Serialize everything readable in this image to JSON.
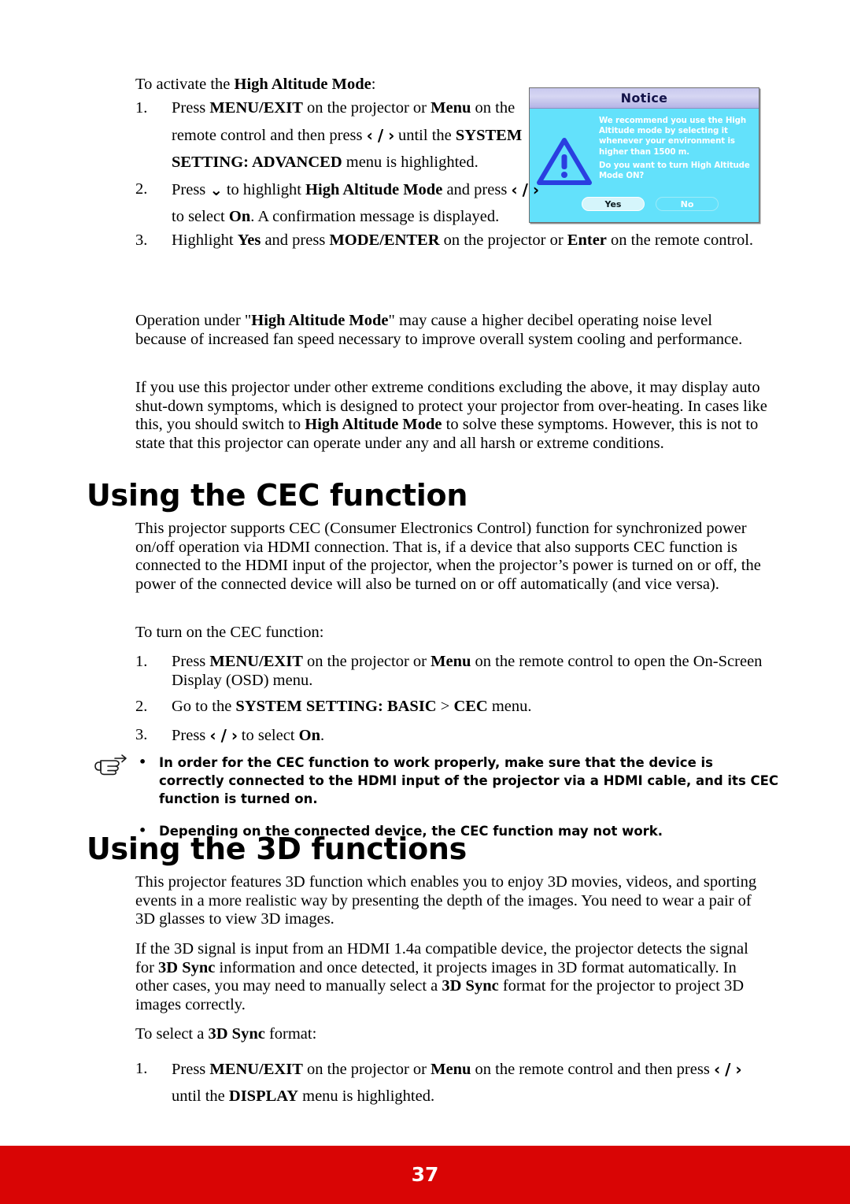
{
  "document": {
    "page_number": "37",
    "footer_color": "#d90505"
  },
  "high_altitude": {
    "lead_in_pre": "To activate the ",
    "lead_in_bold": "High Altitude Mode",
    "lead_in_post": ":",
    "steps": [
      {
        "num": "1.",
        "segments": [
          {
            "t": "Press ",
            "style": "normal"
          },
          {
            "t": "MENU/EXIT",
            "style": "bold"
          },
          {
            "t": " on the projector or ",
            "style": "normal"
          },
          {
            "t": "Menu",
            "style": "bold"
          },
          {
            "t": " on the remote control and then press ",
            "style": "normal"
          },
          {
            "t": "‹ / ›",
            "style": "glyph"
          },
          {
            "t": " until the ",
            "style": "normal"
          },
          {
            "t": "SYSTEM SETTING: ADVANCED",
            "style": "bold"
          },
          {
            "t": " menu is highlighted.",
            "style": "normal"
          }
        ]
      },
      {
        "num": "2.",
        "segments": [
          {
            "t": "Press ",
            "style": "normal"
          },
          {
            "t": "⌄",
            "style": "glyph-down"
          },
          {
            "t": " to highlight ",
            "style": "normal"
          },
          {
            "t": "High Altitude Mode",
            "style": "bold"
          },
          {
            "t": " and press ",
            "style": "normal"
          },
          {
            "t": "‹ / ›",
            "style": "glyph"
          },
          {
            "t": " to select ",
            "style": "normal"
          },
          {
            "t": "On",
            "style": "bold"
          },
          {
            "t": ". A confirmation message is displayed.",
            "style": "normal"
          }
        ]
      },
      {
        "num": "3.",
        "segments": [
          {
            "t": "Highlight ",
            "style": "normal"
          },
          {
            "t": "Yes",
            "style": "bold"
          },
          {
            "t": " and press ",
            "style": "normal"
          },
          {
            "t": "MODE/ENTER",
            "style": "bold"
          },
          {
            "t": " on the projector or ",
            "style": "normal"
          },
          {
            "t": "Enter",
            "style": "bold"
          },
          {
            "t": " on the remote control.",
            "style": "normal"
          }
        ]
      }
    ],
    "paragraph_1": [
      {
        "t": "Operation under \"",
        "style": "normal"
      },
      {
        "t": "High Altitude Mode",
        "style": "bold"
      },
      {
        "t": "\" may cause a higher decibel operating noise level because of increased fan speed necessary to improve overall system cooling and performance.",
        "style": "normal"
      }
    ],
    "paragraph_2": [
      {
        "t": "If you use this projector under other extreme conditions excluding the above, it may display auto shut-down symptoms, which is designed to protect your projector from over-heating. In cases like this, you should switch to ",
        "style": "normal"
      },
      {
        "t": "High Altitude Mode",
        "style": "bold"
      },
      {
        "t": " to solve these symptoms. However, this is not to state that this projector can operate under any and all harsh or extreme conditions.",
        "style": "normal"
      }
    ]
  },
  "notice_dialog": {
    "title": "Notice",
    "message_top": "We recommend you use the High Altitude mode by selecting it whenever your environment is higher than 1500 m.",
    "message_bottom": "Do you want to turn High Altitude Mode ON?",
    "buttons": [
      {
        "label": "Yes",
        "selected": true
      },
      {
        "label": "No",
        "selected": false
      }
    ],
    "background_color": "#63e1fb",
    "titlebar_color": "#d6d6f2",
    "icon_color": "#2a3fe0"
  },
  "cec_section": {
    "heading": "Using the CEC function",
    "paragraph_1": "This projector supports CEC (Consumer Electronics Control) function for synchronized power on/off operation via HDMI connection. That is, if a device that also supports CEC function is connected to the HDMI input of the projector, when the projector’s power is turned on or off, the power of the connected device will also be turned on or off automatically (and vice versa).",
    "lead_in": "To turn on the CEC function:",
    "steps": [
      {
        "num": "1.",
        "segments": [
          {
            "t": "Press ",
            "style": "normal"
          },
          {
            "t": "MENU/EXIT",
            "style": "bold"
          },
          {
            "t": " on the projector or ",
            "style": "normal"
          },
          {
            "t": "Menu",
            "style": "bold"
          },
          {
            "t": " on the remote control to open the On-Screen Display (OSD) menu.",
            "style": "normal"
          }
        ]
      },
      {
        "num": "2.",
        "segments": [
          {
            "t": "Go to the ",
            "style": "normal"
          },
          {
            "t": "SYSTEM SETTING: BASIC",
            "style": "bold"
          },
          {
            "t": " > ",
            "style": "normal"
          },
          {
            "t": "CEC",
            "style": "bold"
          },
          {
            "t": " menu.",
            "style": "normal"
          }
        ]
      },
      {
        "num": "3.",
        "segments": [
          {
            "t": "Press ",
            "style": "normal"
          },
          {
            "t": "‹ / ›",
            "style": "glyph"
          },
          {
            "t": " to select ",
            "style": "normal"
          },
          {
            "t": "On",
            "style": "bold"
          },
          {
            "t": ".",
            "style": "normal"
          }
        ]
      }
    ],
    "notes": [
      "In order for the CEC function to work properly, make sure that the device is correctly connected to the HDMI input of the projector via a HDMI cable, and its CEC function is turned on.",
      "Depending on the connected device, the CEC function may not work."
    ],
    "note_bullet": "•"
  },
  "three_d_section": {
    "heading": "Using the 3D functions",
    "paragraph_1": "This projector features 3D function which enables you to enjoy 3D movies, videos, and sporting events in a more realistic way by presenting the depth of the images. You need to wear a pair of 3D glasses to view 3D images.",
    "paragraph_2": [
      {
        "t": "If the 3D signal is input from an HDMI 1.4a compatible device, the projector detects the signal for ",
        "style": "normal"
      },
      {
        "t": "3D Sync",
        "style": "bold"
      },
      {
        "t": " information and once detected, it projects images in 3D format automatically. In other cases, you may need to manually select a ",
        "style": "normal"
      },
      {
        "t": "3D Sync",
        "style": "bold"
      },
      {
        "t": " format for the projector to project 3D images correctly.",
        "style": "normal"
      }
    ],
    "lead_in": [
      {
        "t": "To select a ",
        "style": "normal"
      },
      {
        "t": "3D Sync",
        "style": "bold"
      },
      {
        "t": " format:",
        "style": "normal"
      }
    ],
    "steps": [
      {
        "num": "1.",
        "segments": [
          {
            "t": "Press ",
            "style": "normal"
          },
          {
            "t": "MENU/EXIT",
            "style": "bold"
          },
          {
            "t": " on the projector or ",
            "style": "normal"
          },
          {
            "t": "Menu",
            "style": "bold"
          },
          {
            "t": " on the remote control and then press ",
            "style": "normal"
          },
          {
            "t": "‹ / ›",
            "style": "glyph"
          },
          {
            "t": " until the ",
            "style": "normal"
          },
          {
            "t": "DISPLAY",
            "style": "bold"
          },
          {
            "t": " menu is highlighted.",
            "style": "normal"
          }
        ]
      }
    ]
  }
}
